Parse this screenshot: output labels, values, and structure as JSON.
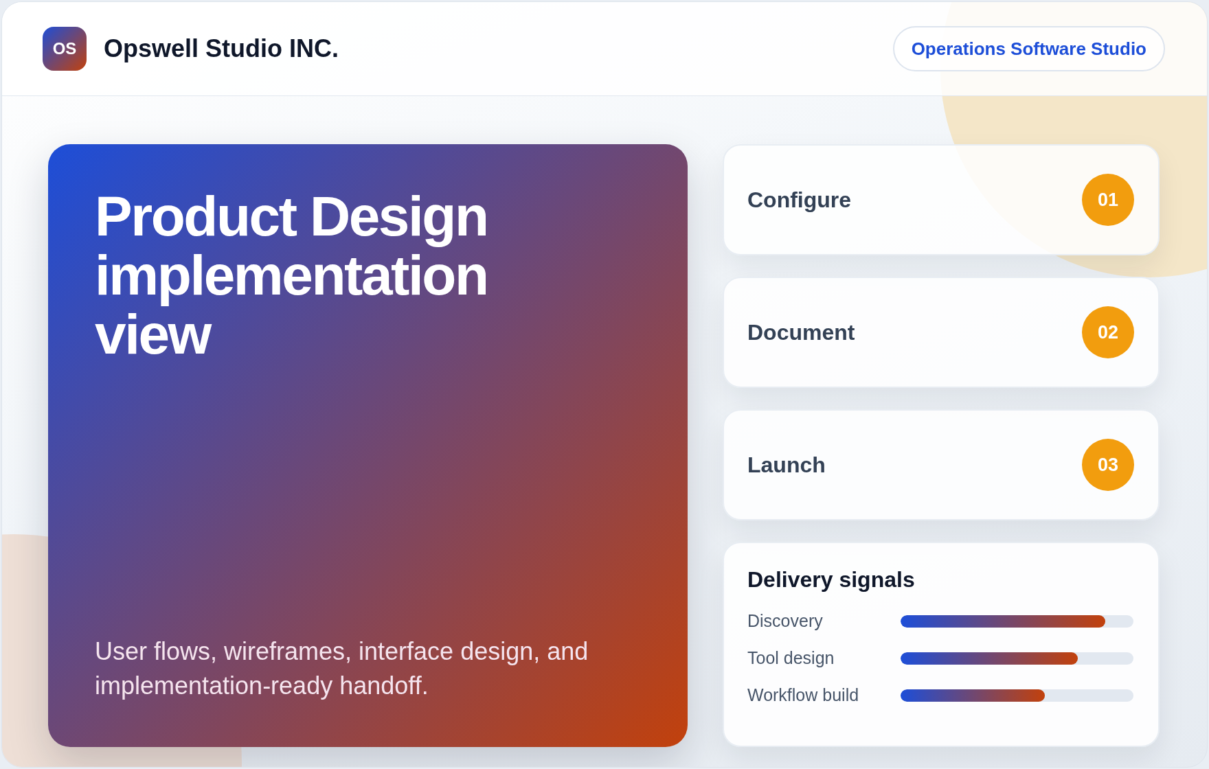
{
  "header": {
    "logo": "OS",
    "title": "Opswell Studio INC.",
    "tag": "Operations Software Studio"
  },
  "hero": {
    "title": "Product Design implementation view",
    "description": "User flows, wireframes, interface design, and implementation-ready handoff."
  },
  "steps": [
    {
      "label": "Configure",
      "number": "01"
    },
    {
      "label": "Document",
      "number": "02"
    },
    {
      "label": "Launch",
      "number": "03"
    }
  ],
  "signals": {
    "title": "Delivery signals",
    "rows": [
      {
        "label": "Discovery",
        "level": 0.88
      },
      {
        "label": "Tool design",
        "level": 0.76
      },
      {
        "label": "Workflow build",
        "level": 0.62
      }
    ]
  }
}
